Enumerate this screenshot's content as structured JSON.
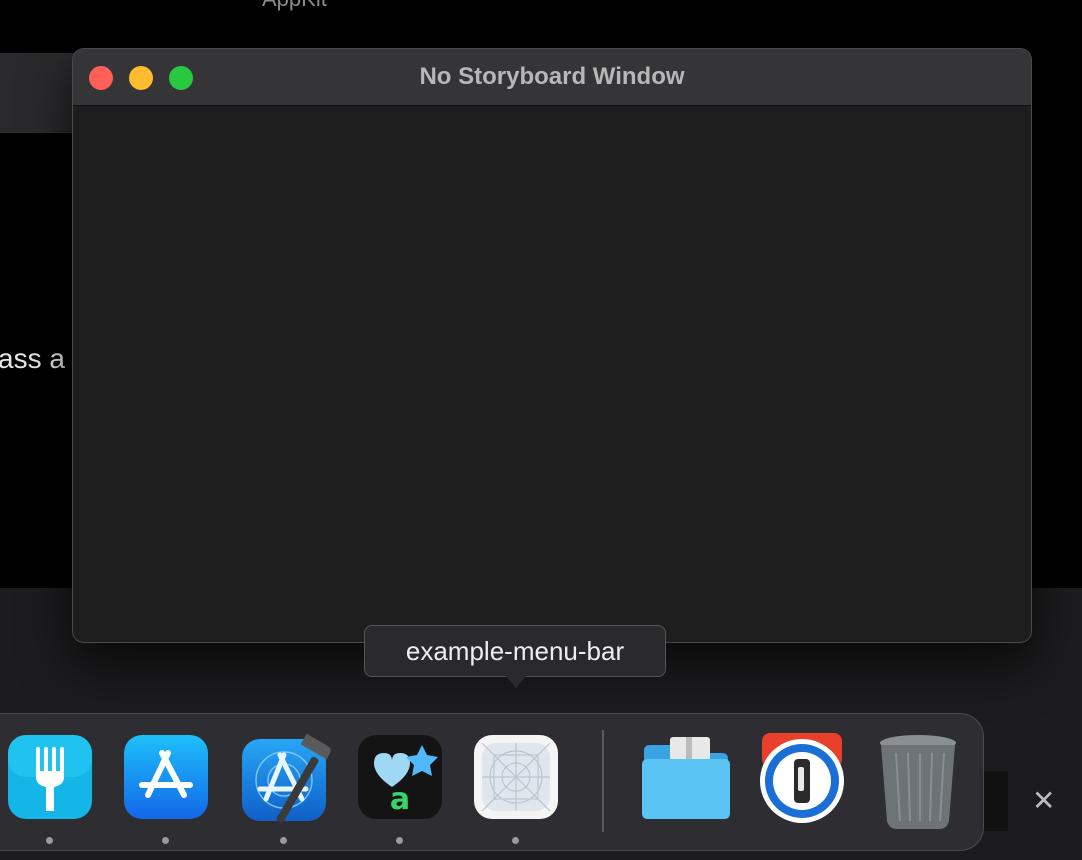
{
  "background": {
    "top_text": "AppKit",
    "mid_text": "ass a"
  },
  "window": {
    "title": "No Storyboard Window",
    "controls": [
      "close",
      "minimize",
      "zoom"
    ]
  },
  "tooltip": {
    "text": "example-menu-bar"
  },
  "dock": {
    "items": [
      {
        "name": "fork-app-icon",
        "running": true
      },
      {
        "name": "app-store-icon",
        "running": true
      },
      {
        "name": "xcode-icon",
        "running": true
      },
      {
        "name": "sf-symbols-icon",
        "running": true
      },
      {
        "name": "example-menu-bar-app-icon",
        "running": true
      },
      {
        "name": "downloads-folder-icon",
        "running": false
      },
      {
        "name": "1password-icon",
        "running": false
      },
      {
        "name": "trash-icon",
        "running": false
      }
    ]
  },
  "close_glyph": "✕",
  "colors": {
    "close": "#fe5f57",
    "minimize": "#febc2e",
    "zoom": "#28c840"
  }
}
